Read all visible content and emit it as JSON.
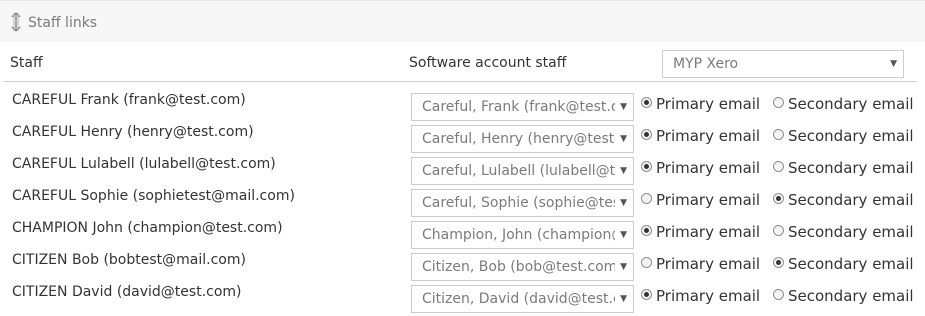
{
  "panel": {
    "title": "Staff links",
    "icon": "sort-vertical-icon"
  },
  "columns": {
    "staff": "Staff",
    "software": "Software account staff"
  },
  "software_select": {
    "value": "MYP Xero"
  },
  "radio_labels": {
    "primary": "Primary email",
    "secondary": "Secondary email"
  },
  "rows": [
    {
      "name": "CAREFUL Frank (frank@test.com)",
      "account": "Careful, Frank (frank@test.com)",
      "email": "primary"
    },
    {
      "name": "CAREFUL Henry (henry@test.com)",
      "account": "Careful, Henry (henry@test.com)",
      "email": "primary"
    },
    {
      "name": "CAREFUL Lulabell (lulabell@test.com)",
      "account": "Careful, Lulabell (lulabell@test.com)",
      "email": "primary"
    },
    {
      "name": "CAREFUL Sophie (sophietest@mail.com)",
      "account": "Careful, Sophie (sophie@test.com)",
      "email": "secondary"
    },
    {
      "name": "CHAMPION John (champion@test.com)",
      "account": "Champion, John (champion@test.com)",
      "email": "primary"
    },
    {
      "name": "CITIZEN Bob (bobtest@mail.com)",
      "account": "Citizen, Bob (bob@test.com)",
      "email": "secondary"
    },
    {
      "name": "CITIZEN David (david@test.com)",
      "account": "Citizen, David (david@test.com)",
      "email": "primary"
    }
  ]
}
